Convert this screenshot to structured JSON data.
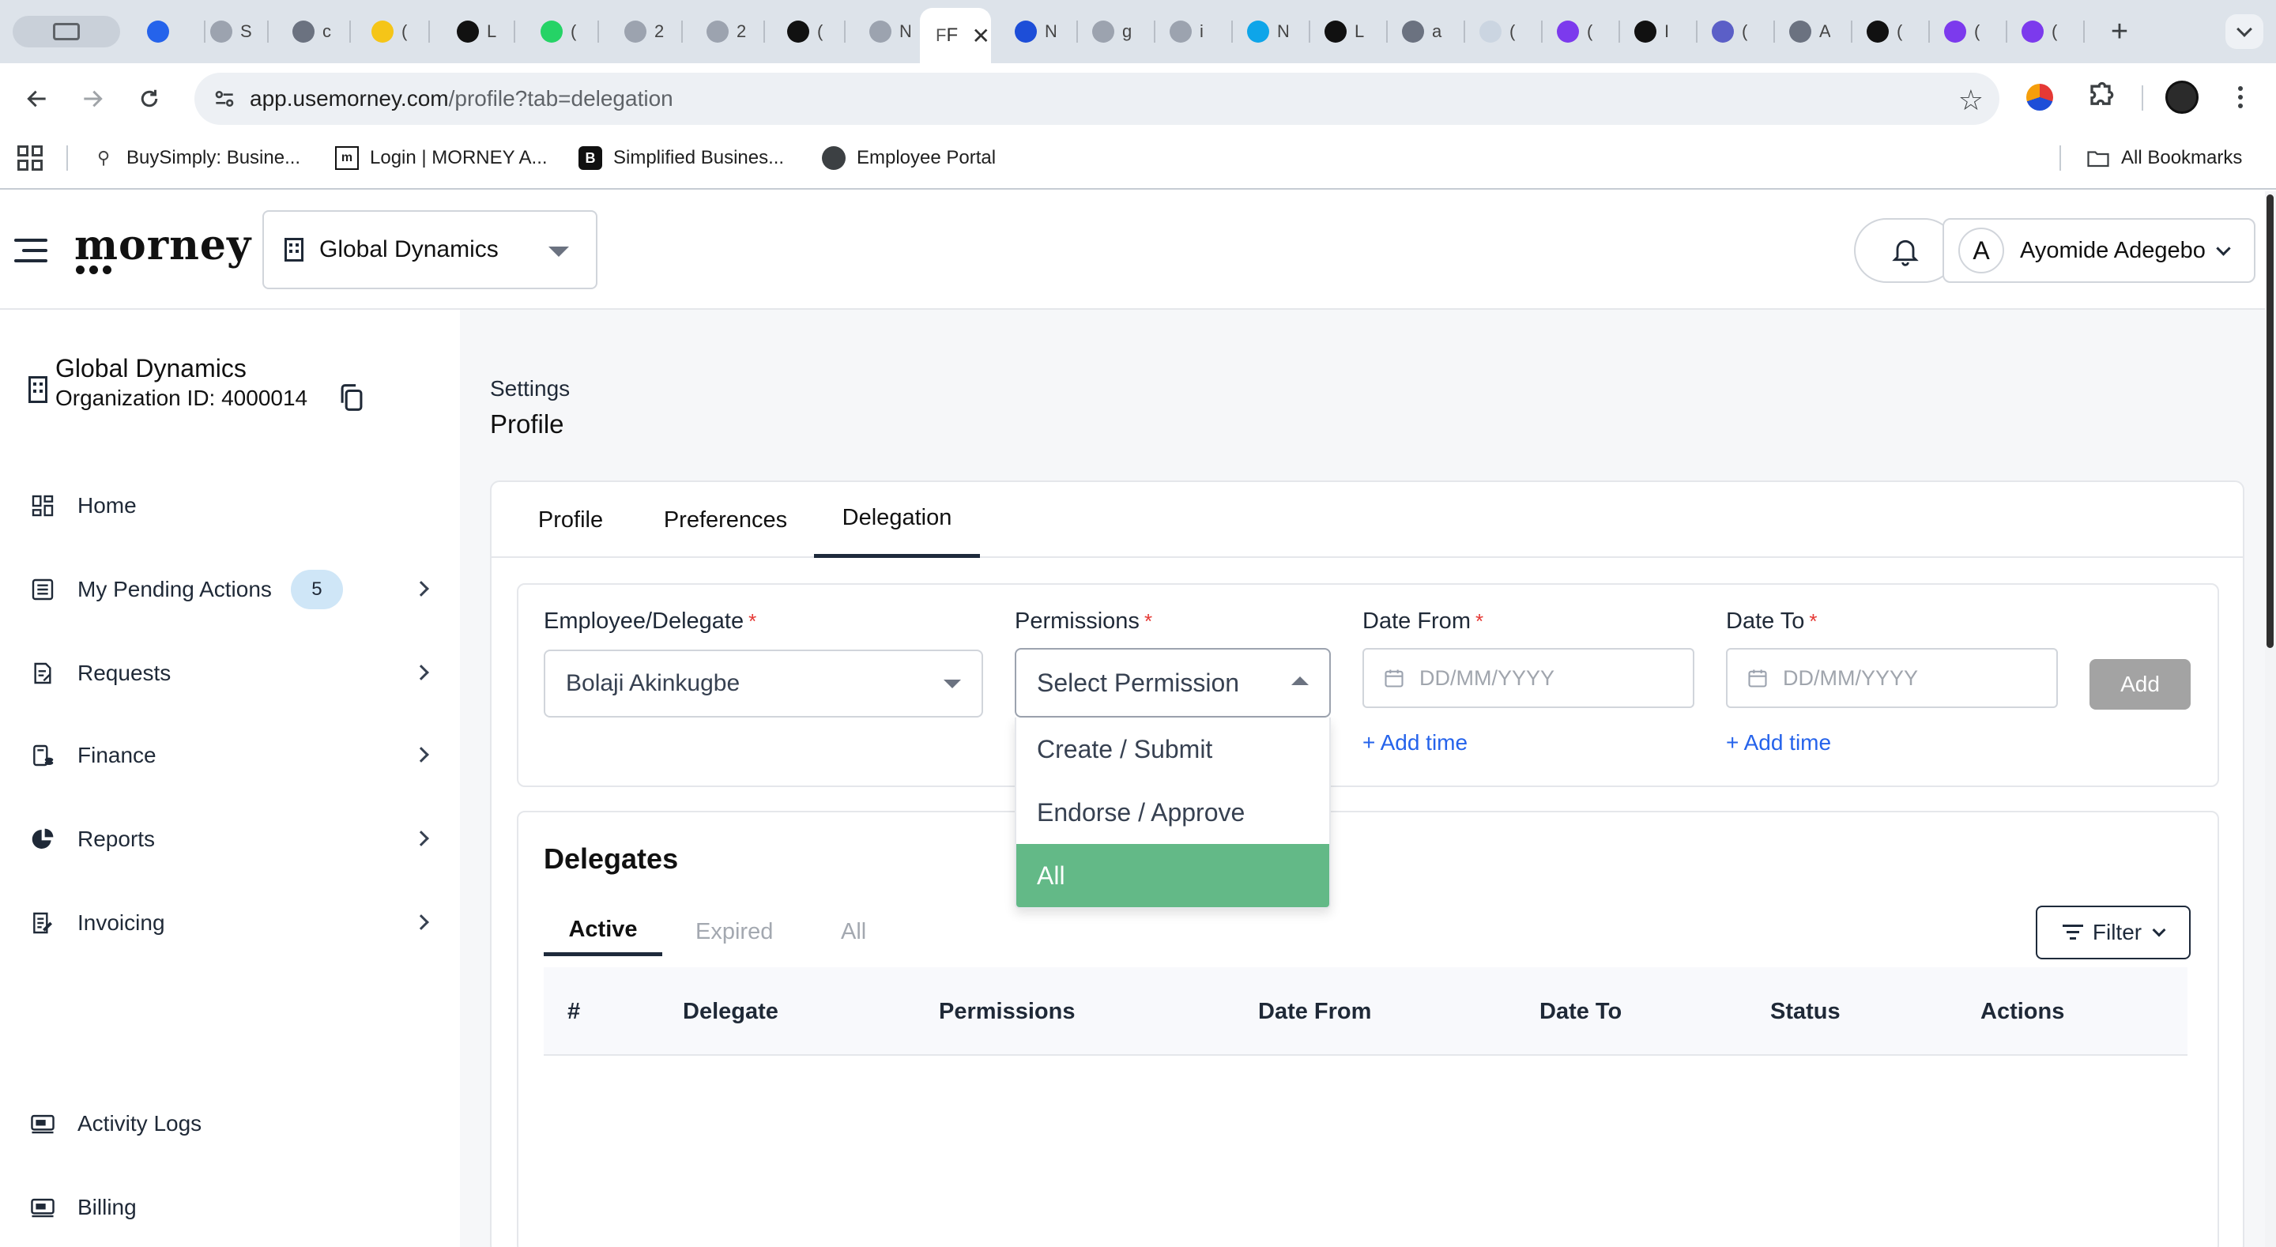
{
  "browser": {
    "tabs": [
      {
        "icon": "card-icon",
        "color": "#6b7280",
        "title": ""
      },
      {
        "icon": "heart-icon",
        "color": "#2563eb",
        "title": ""
      },
      {
        "icon": "globe-icon",
        "color": "#9ca3af",
        "title": "S"
      },
      {
        "icon": "calendar-icon",
        "color": "#6b7280",
        "title": "c"
      },
      {
        "icon": "note-icon",
        "color": "#f5c518",
        "title": "("
      },
      {
        "icon": "morney-icon",
        "color": "#111111",
        "title": "L"
      },
      {
        "icon": "whatsapp-icon",
        "color": "#25d366",
        "title": "("
      },
      {
        "icon": "globe-icon",
        "color": "#9ca3af",
        "title": "2"
      },
      {
        "icon": "globe-icon",
        "color": "#9ca3af",
        "title": "2"
      },
      {
        "icon": "c-icon",
        "color": "#111111",
        "title": "("
      },
      {
        "icon": "globe-icon",
        "color": "#9ca3af",
        "title": "N"
      }
    ],
    "active_tab": {
      "title": "F",
      "close": "✕"
    },
    "tabs_right": [
      {
        "icon": "layers-icon",
        "color": "#1d4ed8",
        "title": "N"
      },
      {
        "icon": "bird-icon",
        "color": "#9ca3af",
        "title": "g"
      },
      {
        "icon": "doc-icon",
        "color": "#9ca3af",
        "title": "i"
      },
      {
        "icon": "x-icon",
        "color": "#0ea5e9",
        "title": "N"
      },
      {
        "icon": "b-icon",
        "color": "#111111",
        "title": "L"
      },
      {
        "icon": "b-icon",
        "color": "#6b7280",
        "title": "a"
      },
      {
        "icon": "blank-icon",
        "color": "#cbd5e1",
        "title": "("
      },
      {
        "icon": "g-icon",
        "color": "#7c3aed",
        "title": "("
      },
      {
        "icon": "morney-icon",
        "color": "#111111",
        "title": "I"
      },
      {
        "icon": "teams-icon",
        "color": "#5b5fc7",
        "title": "("
      },
      {
        "icon": "grid-icon",
        "color": "#6b7280",
        "title": "A"
      },
      {
        "icon": "openai-icon",
        "color": "#111111",
        "title": "("
      },
      {
        "icon": "g-icon",
        "color": "#7c3aed",
        "title": "("
      },
      {
        "icon": "g-icon",
        "color": "#7c3aed",
        "title": "("
      }
    ],
    "new_tab": "+",
    "url_host": "app.usemorney.com",
    "url_path": "/profile?tab=delegation",
    "bookmarks": [
      {
        "icon": "bike-icon",
        "label": "BuySimply: Busine..."
      },
      {
        "icon": "morney-icon",
        "label": "Login | MORNEY A..."
      },
      {
        "icon": "b-icon",
        "label": "Simplified Busines..."
      },
      {
        "icon": "globe-icon",
        "label": "Employee Portal"
      }
    ],
    "all_bookmarks": "All Bookmarks"
  },
  "header": {
    "logo": "morney",
    "org_select": "Global Dynamics",
    "user_initial": "A",
    "user_name": "Ayomide Adegebo"
  },
  "sidebar": {
    "org_name": "Global Dynamics",
    "org_id": "Organization ID: 4000014",
    "items": [
      {
        "label": "Home",
        "icon": "dashboard-icon",
        "chevron": false
      },
      {
        "label": "My Pending Actions",
        "icon": "list-icon",
        "chevron": true,
        "badge": "5"
      },
      {
        "label": "Requests",
        "icon": "request-icon",
        "chevron": true
      },
      {
        "label": "Finance",
        "icon": "finance-icon",
        "chevron": true
      },
      {
        "label": "Reports",
        "icon": "pie-chart-icon",
        "chevron": true
      },
      {
        "label": "Invoicing",
        "icon": "invoice-icon",
        "chevron": true
      }
    ],
    "bottom_items": [
      {
        "label": "Activity Logs",
        "icon": "activity-icon"
      },
      {
        "label": "Billing",
        "icon": "billing-icon"
      }
    ]
  },
  "main": {
    "breadcrumb": "Settings",
    "title": "Profile",
    "tabs": [
      "Profile",
      "Preferences",
      "Delegation"
    ],
    "active_tab": 2,
    "form": {
      "employee_label": "Employee/Delegate",
      "employee_value": "Bolaji Akinkugbe",
      "permissions_label": "Permissions",
      "permissions_placeholder": "Select Permission",
      "date_from_label": "Date From",
      "date_to_label": "Date To",
      "date_placeholder": "DD/MM/YYYY",
      "add_time": "+ Add time",
      "add_button": "Add",
      "required_mark": "*"
    },
    "dropdown": {
      "options": [
        "Create / Submit",
        "Endorse / Approve",
        "All"
      ],
      "highlighted": 2
    },
    "delegates": {
      "title": "Delegates",
      "tabs": [
        "Active",
        "Expired",
        "All"
      ],
      "active_tab": 0,
      "filter_label": "Filter",
      "columns": [
        "#",
        "Delegate",
        "Permissions",
        "Date From",
        "Date To",
        "Status",
        "Actions"
      ]
    }
  },
  "colors": {
    "accent_dark": "#1e2a3b",
    "highlight_green": "#63b987",
    "link_blue": "#2563eb",
    "required_red": "#e53935"
  }
}
